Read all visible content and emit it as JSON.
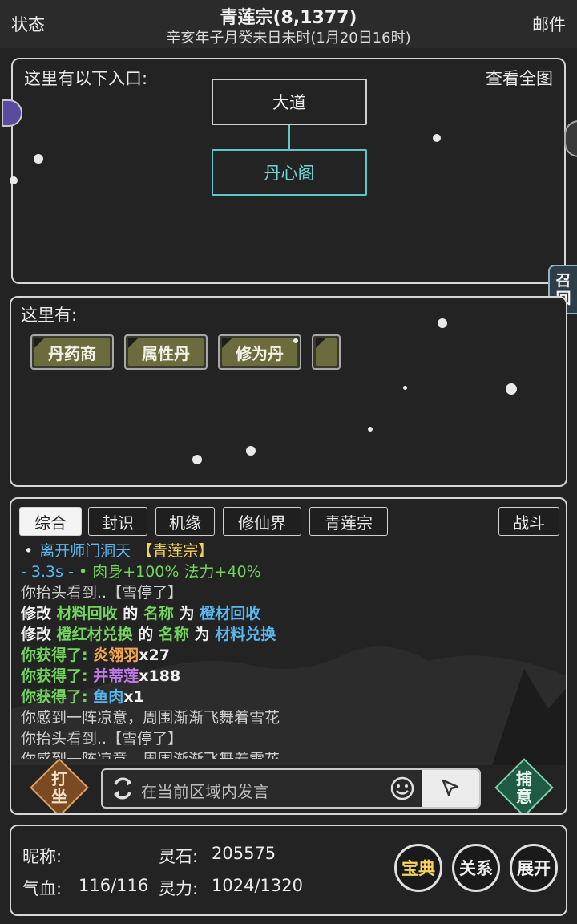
{
  "header": {
    "left": "状态",
    "right": "邮件",
    "title": "青莲宗(8,1377)",
    "subtitle": "辛亥年子月癸未日未时(1月20日16时)"
  },
  "map": {
    "label": "这里有以下入口:",
    "view_full": "查看全图",
    "nodes": [
      "大道",
      "丹心阁"
    ]
  },
  "recall": {
    "label": "召回"
  },
  "here": {
    "label": "这里有:",
    "items": [
      "丹药商",
      "属性丹",
      "修为丹",
      ""
    ]
  },
  "log": {
    "tabs": [
      "综合",
      "封识",
      "机缘",
      "修仙界",
      "青莲宗"
    ],
    "battle": "战斗",
    "lines": {
      "l1_bullet": "•",
      "l1_link": "离开师门洞天",
      "l1_place": "【青莲宗】",
      "l2_time": "- 3.3s -",
      "l2_buff": "• 肉身+100% 法力+40%",
      "l3": "你抬头看到..【雪停了】",
      "l4_a": "修改",
      "l4_b": "材料回收",
      "l4_c": "的",
      "l4_d": "名称",
      "l4_e": "为",
      "l4_f": "橙材回收",
      "l5_a": "修改",
      "l5_b": "橙红材兑换",
      "l5_c": "的",
      "l5_d": "名称",
      "l5_e": "为",
      "l5_f": "材料兑换",
      "l6_a": "你获得了:",
      "l6_b": "炎翎羽",
      "l6_c": "x27",
      "l7_a": "你获得了:",
      "l7_b": "并蒂莲",
      "l7_c": "x188",
      "l8_a": "你获得了:",
      "l8_b": "鱼肉",
      "l8_c": "x1",
      "l9": "你感到一阵凉意，周围渐渐飞舞着雪花",
      "l10": "你抬头看到..【雪停了】",
      "l11": "你感到一阵凉意，周围渐渐飞舞着雪花"
    }
  },
  "actions": {
    "left": "打坐",
    "right": "捕意"
  },
  "chat": {
    "placeholder": "在当前区域内发言"
  },
  "stats": {
    "nickname_label": "昵称:",
    "nickname_value": "",
    "stones_label": "灵石:",
    "stones_value": "205575",
    "hp_label": "气血:",
    "hp_value": "116/116",
    "mp_label": "灵力:",
    "mp_value": "1024/1320",
    "buttons": [
      "宝典",
      "关系",
      "展开"
    ]
  },
  "colors": {
    "accent_teal": "#5ec7c7",
    "link_blue": "#58b6f0",
    "green": "#72d65c",
    "yellow": "#f4d35e",
    "orange": "#f2a654",
    "purple": "#c07ae8"
  }
}
